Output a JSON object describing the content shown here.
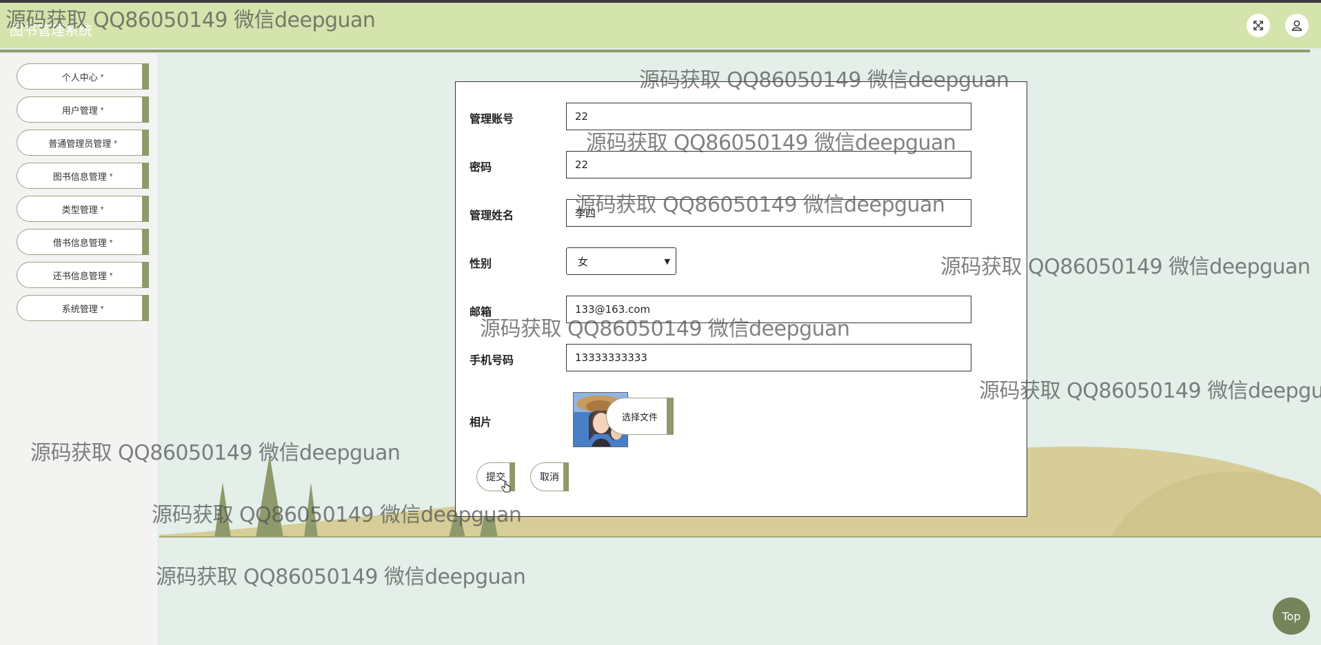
{
  "header": {
    "app_title": "图书管理系统",
    "fullscreen_icon": "fullscreen-icon",
    "user_icon": "user-icon"
  },
  "sidebar": {
    "items": [
      {
        "label": "个人中心",
        "caret": "▾"
      },
      {
        "label": "用户管理",
        "caret": "▾"
      },
      {
        "label": "普通管理员管理",
        "caret": "▾"
      },
      {
        "label": "图书信息管理",
        "caret": "▾"
      },
      {
        "label": "类型管理",
        "caret": "▾"
      },
      {
        "label": "借书信息管理",
        "caret": "▾"
      },
      {
        "label": "还书信息管理",
        "caret": "▾"
      },
      {
        "label": "系统管理",
        "caret": "▾"
      }
    ]
  },
  "form": {
    "fields": {
      "account": {
        "label": "管理账号",
        "value": "22"
      },
      "password": {
        "label": "密码",
        "value": "22"
      },
      "name": {
        "label": "管理姓名",
        "value": "李四"
      },
      "gender": {
        "label": "性别",
        "value": "女"
      },
      "email": {
        "label": "邮箱",
        "value": "133@163.com"
      },
      "phone": {
        "label": "手机号码",
        "value": "13333333333"
      },
      "photo": {
        "label": "相片",
        "choose_file_label": "选择文件"
      }
    },
    "submit_label": "提交",
    "cancel_label": "取消"
  },
  "top_button_label": "Top",
  "watermark": "源码获取 QQ86050149 微信deepguan",
  "colors": {
    "header_bg": "#d5e3ad",
    "accent": "#8e9a6c",
    "page_bg": "#e3efe8"
  }
}
